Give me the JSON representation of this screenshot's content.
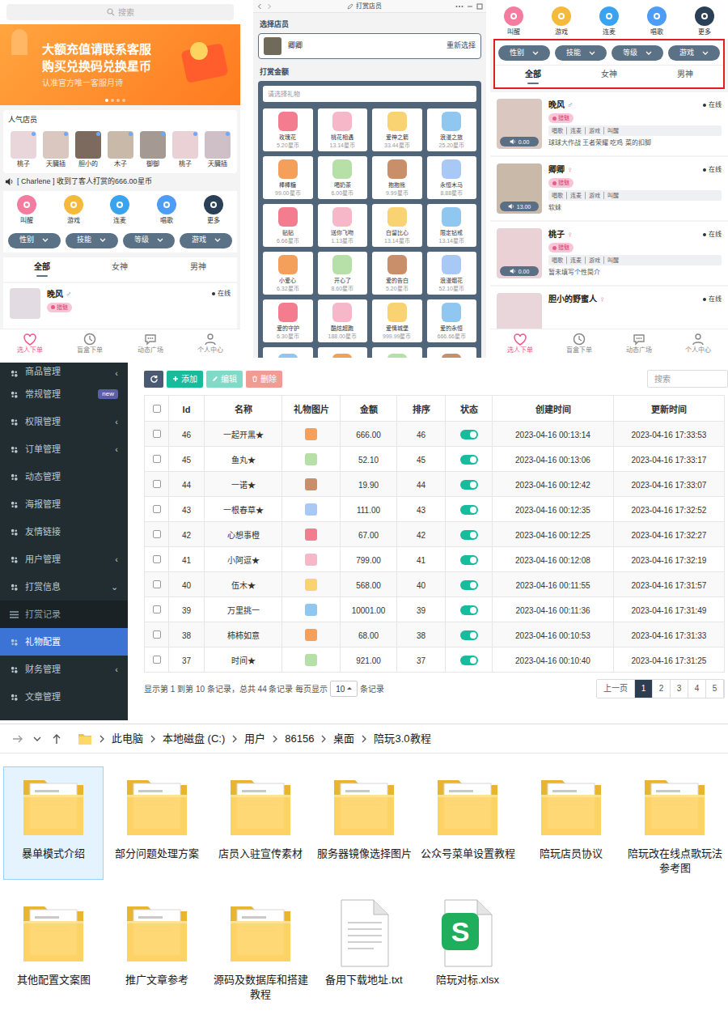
{
  "home": {
    "search": "搜索",
    "banner": [
      "大额充值请联系客服",
      "购买兑换码兑换星币",
      "认准官方唯一客服月诗"
    ],
    "popular_title": "人气店员",
    "popular": [
      "桃子",
      "天臓插",
      "胆小的",
      "木子",
      "御御",
      "桃子",
      "天臓插"
    ],
    "notice": "[ Charlene ] 收到了客人打赏的666.00星币",
    "categories": [
      {
        "label": "叫醒",
        "color": "#f47ca0"
      },
      {
        "label": "游戏",
        "color": "#f5b93b"
      },
      {
        "label": "连麦",
        "color": "#3aa3f0"
      },
      {
        "label": "唱歌",
        "color": "#4d9cf5"
      },
      {
        "label": "更多",
        "color": "#2b3f57"
      }
    ],
    "filters": [
      "性别",
      "技能",
      "等级",
      "游戏"
    ],
    "tabs": [
      {
        "label": "全部",
        "selected": true
      },
      {
        "label": "女神",
        "selected": false
      },
      {
        "label": "男神",
        "selected": false
      }
    ],
    "staff": {
      "name": "晚风",
      "gender": "♂",
      "status": "在线",
      "tag": "猎魅"
    },
    "nav": [
      {
        "label": "选人下单",
        "selected": true
      },
      {
        "label": "盲盒下单",
        "selected": false
      },
      {
        "label": "动态广场",
        "selected": false
      },
      {
        "label": "个人中心",
        "selected": false
      }
    ]
  },
  "reward": {
    "title": "打赏店员",
    "select_label": "选择店员",
    "staff": "卿卿",
    "reselect": "重新选择",
    "amount_label": "打赏金额",
    "placeholder": "请选择礼物",
    "gifts": [
      {
        "name": "玫瑰花",
        "price": "5.20星币"
      },
      {
        "name": "桃花相遇",
        "price": "13.14星币"
      },
      {
        "name": "爱神之箭",
        "price": "33.44星币"
      },
      {
        "name": "浪漫之旅",
        "price": "25.20星币"
      },
      {
        "name": "棒棒糖",
        "price": "99.00星币"
      },
      {
        "name": "喝奶茶",
        "price": "6.00星币"
      },
      {
        "name": "抱抱熊",
        "price": "9.99星币"
      },
      {
        "name": "永恒木马",
        "price": "8.88星币"
      },
      {
        "name": "贴贴",
        "price": "6.66星币"
      },
      {
        "name": "送你飞吻",
        "price": "1.13星币"
      },
      {
        "name": "白留比心",
        "price": "13.14星币"
      },
      {
        "name": "限定钻戒",
        "price": "13.14星币"
      },
      {
        "name": "小爱心",
        "price": "6.32星币"
      },
      {
        "name": "开心了",
        "price": "8.60星币"
      },
      {
        "name": "爱的告白",
        "price": "5.20星币"
      },
      {
        "name": "浪漫烟花",
        "price": "52.10星币"
      },
      {
        "name": "爱的守护",
        "price": "6.30星币"
      },
      {
        "name": "酷炫超跑",
        "price": "188.00星币"
      },
      {
        "name": "爱情城堡",
        "price": "999.99星币"
      },
      {
        "name": "爱的永恒",
        "price": "666.66星币"
      }
    ]
  },
  "list": {
    "categories": [
      {
        "label": "叫醒",
        "color": "#f47ca0"
      },
      {
        "label": "游戏",
        "color": "#f5b93b"
      },
      {
        "label": "连麦",
        "color": "#3aa3f0"
      },
      {
        "label": "唱歌",
        "color": "#4d9cf5"
      },
      {
        "label": "更多",
        "color": "#2b3f57"
      }
    ],
    "filters": [
      "性别",
      "技能",
      "等级",
      "游戏"
    ],
    "tabs": [
      {
        "label": "全部",
        "selected": true
      },
      {
        "label": "女神",
        "selected": false
      },
      {
        "label": "男神",
        "selected": false
      }
    ],
    "staff": [
      {
        "name": "晚风",
        "gender": "♂",
        "status": "在线",
        "tag": "猎魅",
        "skills": [
          "唱歌",
          "连麦",
          "游戏",
          "叫醒"
        ],
        "voice": "0.00",
        "bio": "球球大作战 王者荣耀 吃鸡 菜的扣脚"
      },
      {
        "name": "卿卿",
        "gender": "♀",
        "status": "在线",
        "tag": "猎魅",
        "skills": [
          "唱歌",
          "连麦",
          "游戏",
          "叫醒"
        ],
        "voice": "13.00",
        "bio": "软妹"
      },
      {
        "name": "桃子",
        "gender": "♀",
        "status": "在线",
        "tag": "猎魅",
        "skills": [
          "唱歌",
          "连麦",
          "游戏",
          "叫醒"
        ],
        "voice": "0.00",
        "bio": "暂未填写个性简介"
      },
      {
        "name": "胆小的野蜜人",
        "gender": "♀",
        "status": "在线"
      }
    ],
    "nav": [
      {
        "label": "选人下单",
        "selected": true
      },
      {
        "label": "盲盒下单",
        "selected": false
      },
      {
        "label": "动态广场",
        "selected": false
      },
      {
        "label": "个人中心",
        "selected": false
      }
    ]
  },
  "admin": {
    "sidebar": [
      {
        "label": "商品管理",
        "arrow": "‹",
        "kind": "group",
        "selected": false,
        "expanded": false
      },
      {
        "label": "常规管理",
        "badge": "new",
        "kind": "group",
        "selected": false
      },
      {
        "label": "权限管理",
        "arrow": "‹",
        "kind": "group",
        "selected": false,
        "expanded": false
      },
      {
        "label": "订单管理",
        "arrow": "‹",
        "kind": "group",
        "selected": false,
        "expanded": false
      },
      {
        "label": "动态管理",
        "kind": "group",
        "selected": false
      },
      {
        "label": "海报管理",
        "kind": "group",
        "selected": false
      },
      {
        "label": "友情链接",
        "kind": "group",
        "selected": false
      },
      {
        "label": "用户管理",
        "arrow": "‹",
        "kind": "group",
        "selected": false,
        "expanded": false
      },
      {
        "label": "打赏信息",
        "arrow": "⌄",
        "kind": "group",
        "selected": false,
        "expanded": true
      },
      {
        "label": "打赏记录",
        "kind": "sub",
        "selected": false
      },
      {
        "label": "礼物配置",
        "kind": "sub",
        "selected": true
      },
      {
        "label": "财务管理",
        "arrow": "‹",
        "kind": "group",
        "selected": false,
        "expanded": false
      },
      {
        "label": "文章管理",
        "kind": "group",
        "selected": false
      }
    ],
    "buttons": [
      {
        "label": "添加",
        "disabled": false,
        "color": "#18bc9c"
      },
      {
        "label": "编辑",
        "disabled": true,
        "color": "#18bc9c"
      },
      {
        "label": "删除",
        "disabled": true,
        "color": "#e74c3c"
      }
    ],
    "search": "搜索",
    "all_checked": false,
    "columns": [
      "Id",
      "名称",
      "礼物图片",
      "金额",
      "排序",
      "状态",
      "创建时间",
      "更新时间"
    ],
    "rows": [
      {
        "id": "46",
        "name": "一起开黑★",
        "amount": "666.00",
        "sort": "46",
        "on": true,
        "checked": false,
        "created": "2023-04-16 00:13:14",
        "updated": "2023-04-16 17:33:53"
      },
      {
        "id": "45",
        "name": "鱼丸★",
        "amount": "52.10",
        "sort": "45",
        "on": true,
        "checked": false,
        "created": "2023-04-16 00:13:06",
        "updated": "2023-04-16 17:33:17"
      },
      {
        "id": "44",
        "name": "一诺★",
        "amount": "19.90",
        "sort": "44",
        "on": true,
        "checked": false,
        "created": "2023-04-16 00:12:42",
        "updated": "2023-04-16 17:33:07"
      },
      {
        "id": "43",
        "name": "一根春草★",
        "amount": "111.00",
        "sort": "43",
        "on": true,
        "checked": false,
        "created": "2023-04-16 00:12:35",
        "updated": "2023-04-16 17:32:52"
      },
      {
        "id": "42",
        "name": "心想事橙",
        "amount": "67.00",
        "sort": "42",
        "on": true,
        "checked": false,
        "created": "2023-04-16 00:12:25",
        "updated": "2023-04-16 17:32:27"
      },
      {
        "id": "41",
        "name": "小阿逗★",
        "amount": "799.00",
        "sort": "41",
        "on": true,
        "checked": false,
        "created": "2023-04-16 00:12:08",
        "updated": "2023-04-16 17:32:19"
      },
      {
        "id": "40",
        "name": "伍木★",
        "amount": "568.00",
        "sort": "40",
        "on": true,
        "checked": false,
        "created": "2023-04-16 00:11:55",
        "updated": "2023-04-16 17:31:57"
      },
      {
        "id": "39",
        "name": "万里挑一",
        "amount": "10001.00",
        "sort": "39",
        "on": true,
        "checked": false,
        "created": "2023-04-16 00:11:36",
        "updated": "2023-04-16 17:31:49"
      },
      {
        "id": "38",
        "name": "柿柿如意",
        "amount": "68.00",
        "sort": "38",
        "on": true,
        "checked": false,
        "created": "2023-04-16 00:10:53",
        "updated": "2023-04-16 17:31:33"
      },
      {
        "id": "37",
        "name": "时间★",
        "amount": "921.00",
        "sort": "37",
        "on": true,
        "checked": false,
        "created": "2023-04-16 00:10:40",
        "updated": "2023-04-16 17:31:25"
      }
    ],
    "footer": {
      "summary": "显示第 1 到第 10 条记录，总共 44 条记录 每页显示",
      "page_size": "10",
      "suffix": "条记录",
      "prev": "上一页",
      "pages": [
        {
          "label": "1",
          "selected": true
        },
        {
          "label": "2",
          "selected": false
        },
        {
          "label": "3",
          "selected": false
        },
        {
          "label": "4",
          "selected": false
        },
        {
          "label": "5",
          "selected": false
        }
      ]
    }
  },
  "explorer": {
    "path": [
      "此电脑",
      "本地磁盘 (C:)",
      "用户",
      "86156",
      "桌面",
      "陪玩3.0教程"
    ],
    "items": [
      {
        "name": "暴单模式介绍",
        "kind": "folder",
        "selected": true
      },
      {
        "name": "部分问题处理方案",
        "kind": "folder",
        "selected": false
      },
      {
        "name": "店员入驻宣传素材",
        "kind": "folder",
        "selected": false
      },
      {
        "name": "服务器镜像选择图片",
        "kind": "folder",
        "selected": false
      },
      {
        "name": "公众号菜单设置教程",
        "kind": "folder",
        "selected": false
      },
      {
        "name": "陪玩店员协议",
        "kind": "folder",
        "selected": false
      },
      {
        "name": "陪玩改在线点歌玩法参考图",
        "kind": "folder",
        "selected": false
      },
      {
        "name": "其他配置文案图",
        "kind": "folder",
        "selected": false
      },
      {
        "name": "推广文章参考",
        "kind": "folder",
        "selected": false
      },
      {
        "name": "源码及数据库和搭建教程",
        "kind": "folder",
        "selected": false
      },
      {
        "name": "备用下载地址.txt",
        "kind": "txt",
        "selected": false
      },
      {
        "name": "陪玩对标.xlsx",
        "kind": "xlsx",
        "selected": false,
        "badge": "S"
      }
    ]
  }
}
